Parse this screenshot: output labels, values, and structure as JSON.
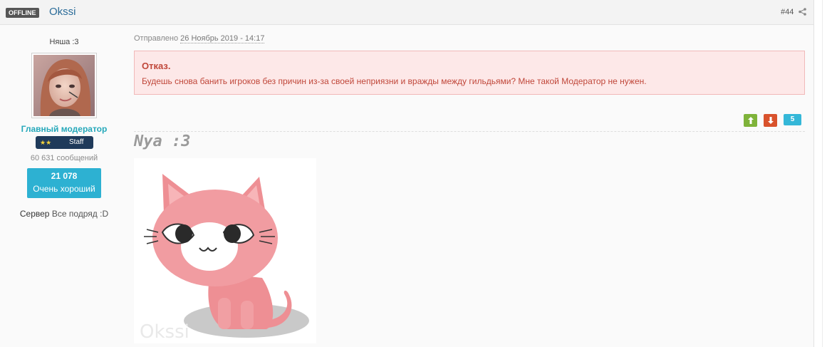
{
  "header": {
    "status_badge": "OFFLINE",
    "author": "Okssi",
    "post_number": "#44",
    "share_icon": "share-icon"
  },
  "author_panel": {
    "custom_title": "Няша :3",
    "group_title": "Главный модератор",
    "staff_stars": "★★",
    "staff_label": "Staff",
    "post_count": "60 631 сообщений",
    "reputation_value": "21 078",
    "reputation_label": "Очень хороший",
    "server_key": "Сервер",
    "server_value": "Все подряд :D"
  },
  "post": {
    "date_prefix": "Отправлено",
    "date": "26 Ноябрь 2019 - 14:17",
    "alert_title": "Отказ.",
    "alert_text": "Будешь снова банить игроков без причин из-за своей неприязни и вражды между гильдьями? Мне такой Модератор не нужен.",
    "vote_up_icon": "arrow-up-icon",
    "vote_down_icon": "arrow-down-icon",
    "rating": "5"
  },
  "signature": {
    "text": "Nya :3",
    "image_watermark": "Okssi"
  },
  "colors": {
    "accent_teal": "#25a8ba",
    "reputation_bg": "#2db1d2",
    "alert_bg": "#fde8e8",
    "alert_text": "#c0473a",
    "vote_up": "#7fb33a",
    "vote_down": "#d9522c"
  }
}
